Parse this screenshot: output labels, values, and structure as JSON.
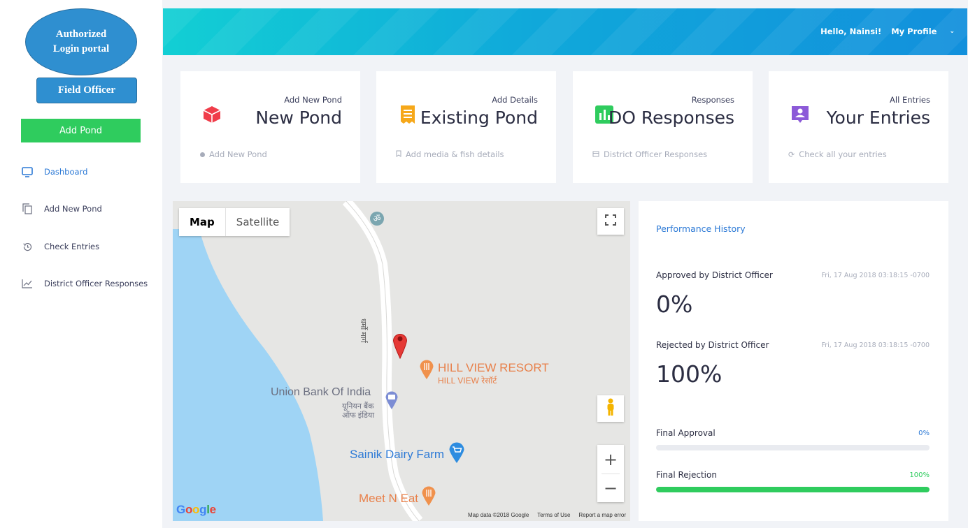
{
  "sidebar": {
    "portal_badge": "Authorized\nLogin portal",
    "role_badge": "Field Officer",
    "add_pond_label": "Add Pond",
    "items": [
      {
        "label": "Dashboard",
        "icon": "monitor-icon",
        "active": true
      },
      {
        "label": "Add New Pond",
        "icon": "copy-icon",
        "active": false
      },
      {
        "label": "Check Entries",
        "icon": "history-icon",
        "active": false
      },
      {
        "label": "District Officer Responses",
        "icon": "line-chart-icon",
        "active": false
      }
    ]
  },
  "header": {
    "greeting": "Hello, Nainsi!",
    "profile_label": "My Profile",
    "gradient": [
      "#12cfd4",
      "#1290dc"
    ]
  },
  "cards": [
    {
      "small": "Add New Pond",
      "big": "New Pond",
      "footer": "Add New Pond",
      "icon": "cube-icon",
      "color": "#f03d4a"
    },
    {
      "small": "Add Details",
      "big": "Existing Pond",
      "footer": "Add media & fish details",
      "icon": "receipt-icon",
      "color": "#f6a81a"
    },
    {
      "small": "Responses",
      "big": "DO Responses",
      "footer": "District Officer Responses",
      "icon": "bar-chart-icon",
      "color": "#2fcc5e"
    },
    {
      "small": "All Entries",
      "big": "Your Entries",
      "footer": "Check all your entries",
      "icon": "user-icon",
      "color": "#8c5ad8"
    }
  ],
  "map": {
    "tab_map": "Map",
    "tab_satellite": "Satellite",
    "road_label": "धर्मो मार्ग",
    "places": {
      "resort": "HILL VIEW RESORT",
      "resort_local": "HILL VIEW रेसॉर्ट",
      "bank": "Union Bank Of India",
      "bank_local_1": "यूनियन बैंक",
      "bank_local_2": "ऑफ इंडिया",
      "dairy": "Sainik Dairy Farm",
      "eat": "Meet N Eat"
    },
    "zoom_in": "+",
    "zoom_out": "−",
    "google": "Google",
    "attribution": [
      "Map data ©2018 Google",
      "Terms of Use",
      "Report a map error"
    ]
  },
  "performance": {
    "title": "Performance History",
    "approved_label": "Approved by District Officer",
    "approved_time": "Fri, 17 Aug 2018 03:18:15 -0700",
    "approved_pct": "0%",
    "rejected_label": "Rejected by District Officer",
    "rejected_time": "Fri, 17 Aug 2018 03:18:15 -0700",
    "rejected_pct": "100%",
    "final_approval_label": "Final Approval",
    "final_approval_value": "0%",
    "final_approval_fraction": 0,
    "final_rejection_label": "Final Rejection",
    "final_rejection_value": "100%",
    "final_rejection_fraction": 1,
    "accent_blue": "#2d7ad6",
    "accent_green": "#2fcc5e"
  }
}
